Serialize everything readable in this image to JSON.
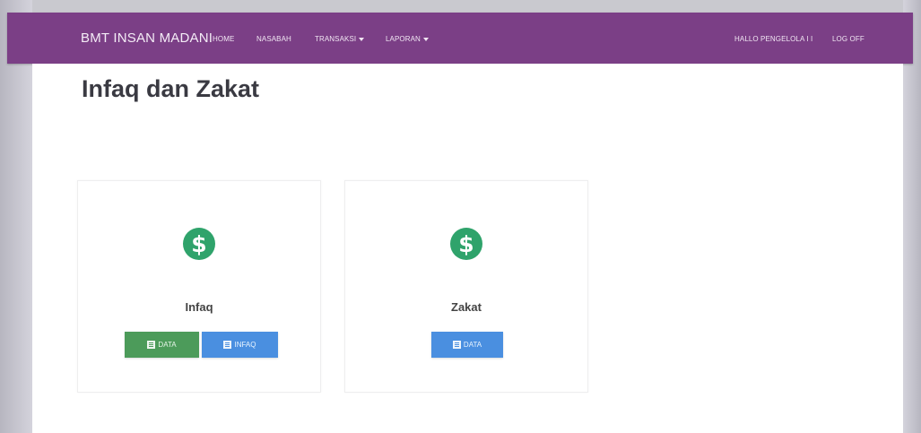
{
  "navbar": {
    "brand": "BMT INSAN MADANI",
    "items": [
      {
        "label": "HOME"
      },
      {
        "label": "NASABAH"
      },
      {
        "label": "TRANSAKSI"
      },
      {
        "label": "LAPORAN"
      }
    ],
    "user_greeting": "HALLO PENGELOLA I I",
    "logoff": "LOG OFF"
  },
  "page": {
    "title": "Infaq dan Zakat"
  },
  "cards": [
    {
      "icon": "dollar-circle-icon",
      "label": "Infaq",
      "buttons": [
        {
          "label": "DATA",
          "color": "#4c9b5a"
        },
        {
          "label": "INFAQ",
          "color": "#4a8fe0"
        }
      ]
    },
    {
      "icon": "dollar-circle-icon",
      "label": "Zakat",
      "buttons": [
        {
          "label": "DATA",
          "color": "#4a8fe0"
        }
      ]
    }
  ],
  "colors": {
    "navbar": "#7b3f86",
    "icon": "#2fa36b",
    "green_button": "#4c9b5a",
    "blue_button": "#4a8fe0"
  }
}
